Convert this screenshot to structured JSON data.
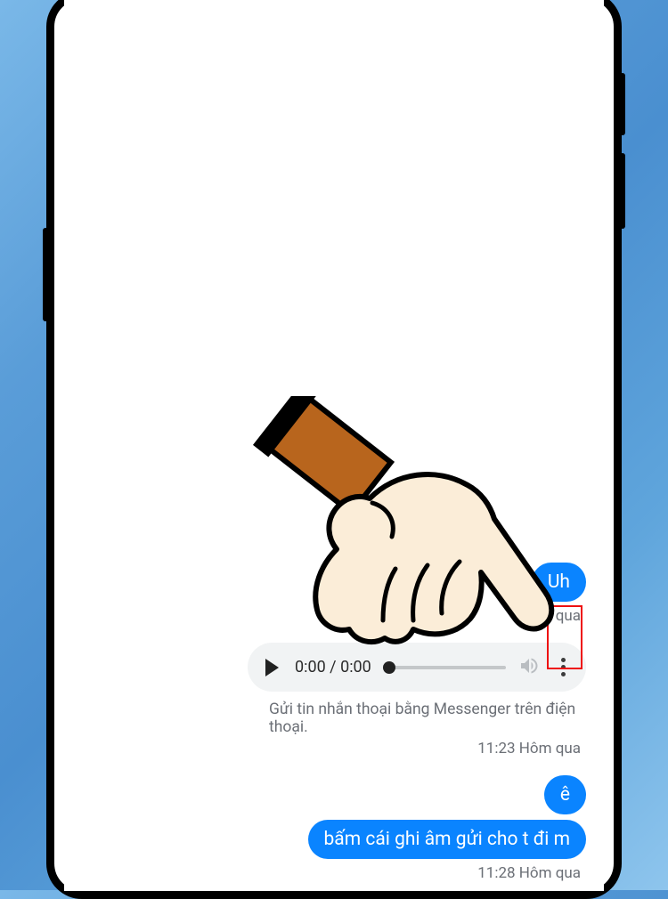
{
  "messages": {
    "m1": {
      "text": "Uh"
    },
    "ts1": "Hôm qua",
    "audio": {
      "current": "0:00",
      "duration": "0:00",
      "separator": " / "
    },
    "caption1": "Gửi tin nhắn thoại bằng Messenger trên điện thoại.",
    "ts2": "11:23 Hôm qua",
    "m2": {
      "text": "ê"
    },
    "m3": {
      "text": "bấm cái ghi âm gửi cho t đi m"
    },
    "ts3": "11:28 Hôm qua"
  }
}
